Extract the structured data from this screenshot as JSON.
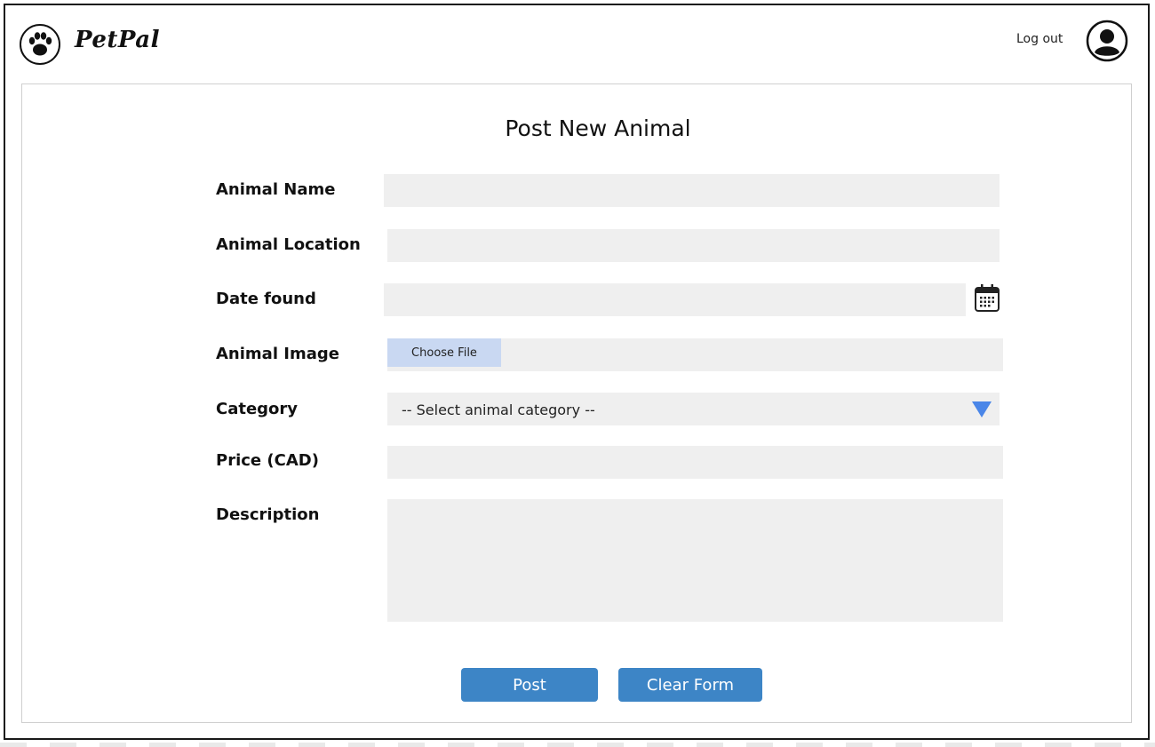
{
  "header": {
    "brand": "PetPal",
    "logout_label": "Log out",
    "logo_icon": "paw-icon",
    "avatar_icon": "user-avatar-icon"
  },
  "form": {
    "title": "Post New Animal",
    "fields": {
      "animal_name": {
        "label": "Animal Name",
        "value": ""
      },
      "animal_location": {
        "label": "Animal Location",
        "value": ""
      },
      "date_found": {
        "label": "Date found",
        "value": "",
        "icon": "calendar-icon"
      },
      "animal_image": {
        "label": "Animal Image",
        "button_label": "Choose File"
      },
      "category": {
        "label": "Category",
        "selected": "-- Select animal category --",
        "icon": "dropdown-arrow-icon"
      },
      "price": {
        "label": "Price (CAD)",
        "value": ""
      },
      "description": {
        "label": "Description",
        "value": ""
      }
    },
    "buttons": {
      "post": "Post",
      "clear": "Clear Form"
    }
  },
  "colors": {
    "field_bg": "#efefef",
    "button_blue": "#3d85c6",
    "file_button_bg": "#c9d8f2",
    "arrow_blue": "#4a86e8"
  }
}
